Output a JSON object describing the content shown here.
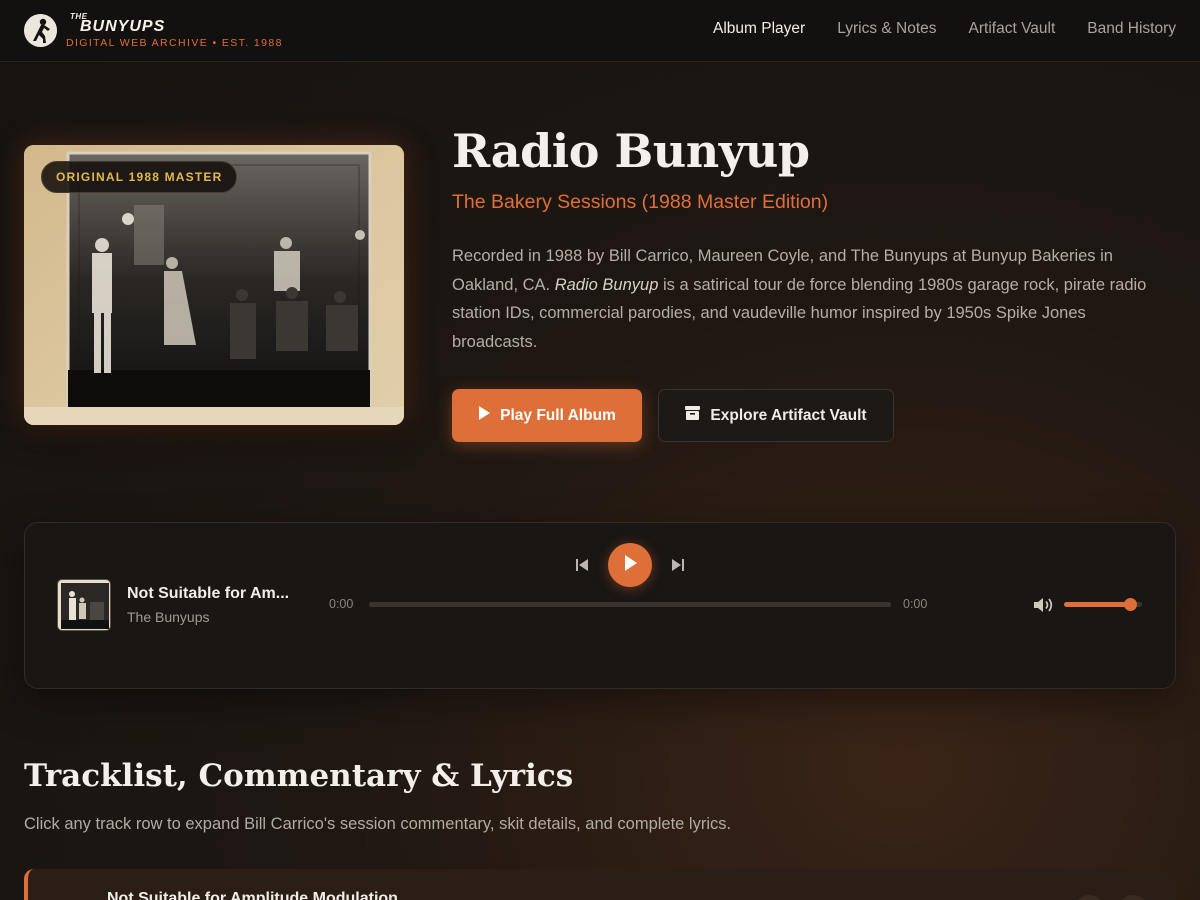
{
  "header": {
    "logo_the": "THE",
    "logo_name": "BUNYUPS",
    "logo_sub": "DIGITAL WEB ARCHIVE • EST. 1988",
    "nav": [
      {
        "label": "Album Player",
        "active": true
      },
      {
        "label": "Lyrics & Notes",
        "active": false
      },
      {
        "label": "Artifact Vault",
        "active": false
      },
      {
        "label": "Band History",
        "active": false
      }
    ]
  },
  "hero": {
    "badge": "ORIGINAL 1988 MASTER",
    "title": "Radio Bunyup",
    "subtitle": "The Bakery Sessions (1988 Master Edition)",
    "description_before": "Recorded in 1988 by Bill Carrico, Maureen Coyle, and The Bunyups at Bunyup Bakeries in Oakland, CA. ",
    "description_em": "Radio Bunyup",
    "description_after": " is a satirical tour de force blending 1980s garage rock, pirate radio station IDs, commercial parodies, and vaudeville humor inspired by 1950s Spike Jones broadcasts.",
    "play_button": "Play Full Album",
    "vault_button": "Explore Artifact Vault"
  },
  "player": {
    "track_title": "Not Suitable for Am...",
    "artist": "The Bunyups",
    "current_time": "0:00",
    "total_time": "0:00",
    "progress": 0,
    "volume": 0.85
  },
  "tracklist": {
    "title": "Tracklist, Commentary & Lyrics",
    "description": "Click any track row to expand Bill Carrico's session commentary, skit details, and complete lyrics.",
    "first_track": "Not Suitable for Amplitude Modulation"
  },
  "colors": {
    "accent": "#de6f38",
    "badge_text": "#e0b84e",
    "background": "#1e1712"
  },
  "icons": [
    "logo-runner-icon",
    "play-icon",
    "archive-box-icon",
    "skip-back-icon",
    "skip-forward-icon",
    "volume-icon"
  ]
}
